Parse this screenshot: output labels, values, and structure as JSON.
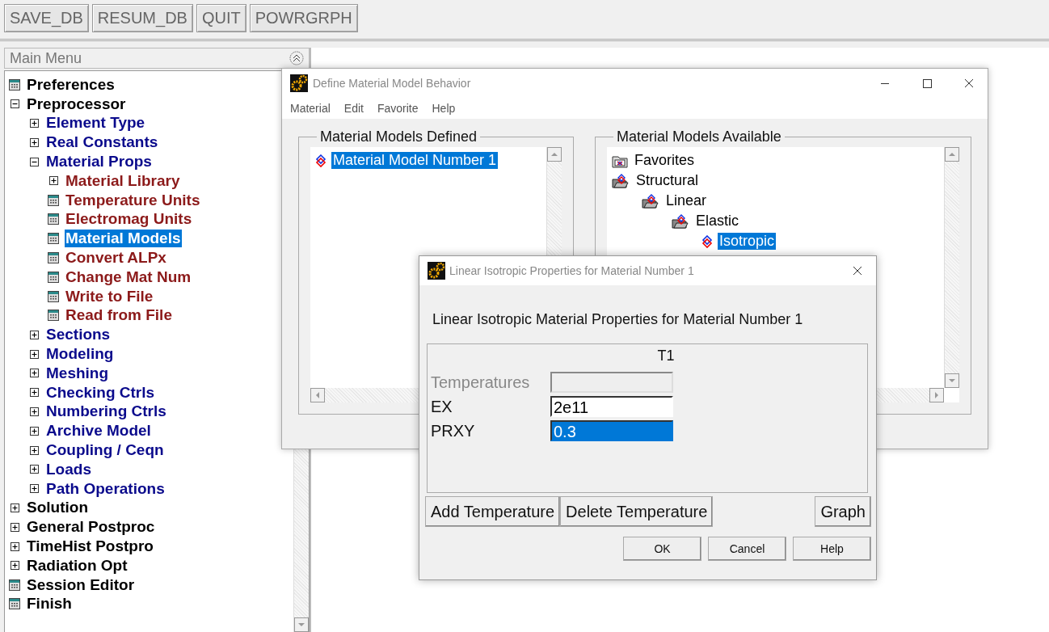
{
  "toolbar": {
    "buttons": [
      "SAVE_DB",
      "RESUM_DB",
      "QUIT",
      "POWRGRPH"
    ]
  },
  "main_menu": {
    "title": "Main Menu",
    "tree": [
      {
        "label": "Preferences",
        "kind": "command",
        "selected": false
      },
      {
        "label": "Preprocessor",
        "kind": "folder",
        "expanded": true,
        "selected": false,
        "children": [
          {
            "label": "Element Type",
            "kind": "folder",
            "expanded": false,
            "selected": false
          },
          {
            "label": "Real Constants",
            "kind": "folder",
            "expanded": false,
            "selected": false
          },
          {
            "label": "Material Props",
            "kind": "folder",
            "expanded": true,
            "selected": false,
            "children": [
              {
                "label": "Material Library",
                "kind": "folder",
                "expanded": false,
                "selected": false
              },
              {
                "label": "Temperature Units",
                "kind": "command",
                "selected": false
              },
              {
                "label": "Electromag Units",
                "kind": "command",
                "selected": false
              },
              {
                "label": "Material Models",
                "kind": "command",
                "selected": true
              },
              {
                "label": "Convert ALPx",
                "kind": "command",
                "selected": false
              },
              {
                "label": "Change Mat Num",
                "kind": "command",
                "selected": false
              },
              {
                "label": "Write to File",
                "kind": "command",
                "selected": false
              },
              {
                "label": "Read from File",
                "kind": "command",
                "selected": false
              }
            ]
          },
          {
            "label": "Sections",
            "kind": "folder",
            "expanded": false,
            "selected": false
          },
          {
            "label": "Modeling",
            "kind": "folder",
            "expanded": false,
            "selected": false
          },
          {
            "label": "Meshing",
            "kind": "folder",
            "expanded": false,
            "selected": false
          },
          {
            "label": "Checking Ctrls",
            "kind": "folder",
            "expanded": false,
            "selected": false
          },
          {
            "label": "Numbering Ctrls",
            "kind": "folder",
            "expanded": false,
            "selected": false
          },
          {
            "label": "Archive Model",
            "kind": "folder",
            "expanded": false,
            "selected": false
          },
          {
            "label": "Coupling / Ceqn",
            "kind": "folder",
            "expanded": false,
            "selected": false
          },
          {
            "label": "Loads",
            "kind": "folder",
            "expanded": false,
            "selected": false
          },
          {
            "label": "Path Operations",
            "kind": "folder",
            "expanded": false,
            "selected": false
          }
        ]
      },
      {
        "label": "Solution",
        "kind": "folder",
        "expanded": false,
        "selected": false
      },
      {
        "label": "General Postproc",
        "kind": "folder",
        "expanded": false,
        "selected": false
      },
      {
        "label": "TimeHist Postpro",
        "kind": "folder",
        "expanded": false,
        "selected": false
      },
      {
        "label": "Radiation Opt",
        "kind": "folder",
        "expanded": false,
        "selected": false
      },
      {
        "label": "Session Editor",
        "kind": "command",
        "selected": false
      },
      {
        "label": "Finish",
        "kind": "command",
        "selected": false
      }
    ]
  },
  "define_dialog": {
    "title": "Define Material Model Behavior",
    "menu": [
      "Material",
      "Edit",
      "Favorite",
      "Help"
    ],
    "defined": {
      "title": "Material Models Defined",
      "items": [
        {
          "label": "Material Model Number 1",
          "selected": true
        }
      ]
    },
    "available": {
      "title": "Material Models Available",
      "tree": [
        {
          "label": "Favorites",
          "kind": "favorites",
          "selected": false
        },
        {
          "label": "Structural",
          "kind": "folder",
          "selected": false,
          "children": [
            {
              "label": "Linear",
              "kind": "folder",
              "selected": false,
              "children": [
                {
                  "label": "Elastic",
                  "kind": "folder",
                  "selected": false,
                  "children": [
                    {
                      "label": "Isotropic",
                      "kind": "model",
                      "selected": true
                    }
                  ]
                }
              ]
            }
          ]
        }
      ]
    }
  },
  "props_dialog": {
    "title": "Linear Isotropic Properties for Material Number 1",
    "heading": "Linear Isotropic Material Properties for Material Number 1",
    "column": "T1",
    "rows": [
      {
        "label": "Temperatures",
        "disabled": true,
        "selected": false
      },
      {
        "label": "EX",
        "value": "2e11",
        "disabled": false,
        "selected": false
      },
      {
        "label": "PRXY",
        "value": "0.3",
        "disabled": false,
        "selected": true
      }
    ],
    "buttons": [
      "Add Temperature",
      "Delete Temperature",
      "Graph"
    ],
    "footer_buttons": [
      "OK",
      "Cancel",
      "Help"
    ]
  }
}
